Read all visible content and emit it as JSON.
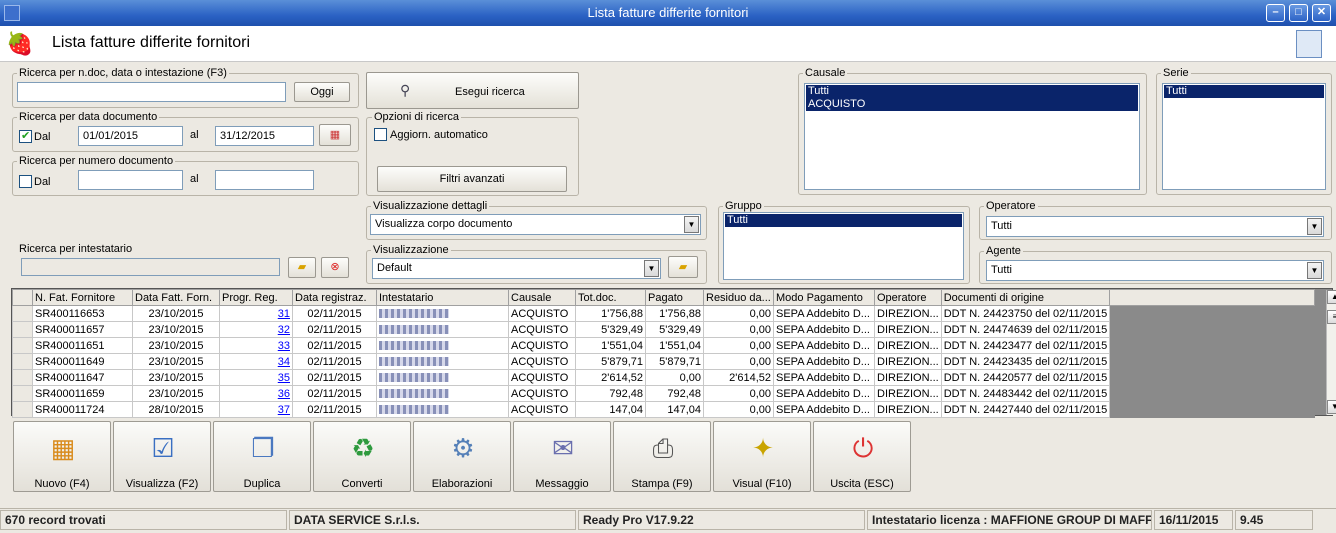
{
  "window": {
    "title": "Lista fatture differite fornitori"
  },
  "header": {
    "title": "Lista fatture differite fornitori"
  },
  "search_text": {
    "group_label": "Ricerca per n.doc, data o intestazione (F3)",
    "value": "",
    "oggi_label": "Oggi"
  },
  "search_date": {
    "group_label": "Ricerca per data documento",
    "dal_label": "Dal",
    "from": "01/01/2015",
    "al_label": "al",
    "to": "31/12/2015",
    "checked": true
  },
  "search_number": {
    "group_label": "Ricerca per numero documento",
    "dal_label": "Dal",
    "from": "",
    "al_label": "al",
    "to": "",
    "checked": false
  },
  "search_holder": {
    "group_label": "Ricerca per intestatario",
    "value": ""
  },
  "run_search_label": "Esegui ricerca",
  "search_options": {
    "group_label": "Opzioni di ricerca",
    "auto_update_label": "Aggiorn. automatico",
    "advanced_filters_label": "Filtri avanzati"
  },
  "detail_view": {
    "group_label": "Visualizzazione dettagli",
    "selected": "Visualizza corpo documento"
  },
  "view": {
    "group_label": "Visualizzazione",
    "selected": "Default"
  },
  "causale": {
    "group_label": "Causale",
    "items": [
      "Tutti",
      "ACQUISTO"
    ]
  },
  "serie": {
    "group_label": "Serie",
    "items": [
      "Tutti"
    ]
  },
  "gruppo": {
    "group_label": "Gruppo",
    "items": [
      "Tutti"
    ]
  },
  "operatore": {
    "group_label": "Operatore",
    "selected": "Tutti"
  },
  "agente": {
    "group_label": "Agente",
    "selected": "Tutti"
  },
  "table": {
    "columns": [
      "N. Fat. Fornitore",
      "Data Fatt. Forn.",
      "Progr. Reg.",
      "Data registraz.",
      "Intestatario",
      "Causale",
      "Tot.doc.",
      "Pagato",
      "Residuo da...",
      "Modo Pagamento",
      "Operatore",
      "Documenti di origine"
    ],
    "rows": [
      [
        "SR400116653",
        "23/10/2015",
        "31",
        "02/11/2015",
        "",
        "ACQUISTO",
        "1'756,88",
        "1'756,88",
        "0,00",
        "SEPA Addebito D...",
        "DIREZION...",
        "DDT N. 24423750 del 02/11/2015"
      ],
      [
        "SR400011657",
        "23/10/2015",
        "32",
        "02/11/2015",
        "",
        "ACQUISTO",
        "5'329,49",
        "5'329,49",
        "0,00",
        "SEPA Addebito D...",
        "DIREZION...",
        "DDT N. 24474639 del 02/11/2015"
      ],
      [
        "SR400011651",
        "23/10/2015",
        "33",
        "02/11/2015",
        "",
        "ACQUISTO",
        "1'551,04",
        "1'551,04",
        "0,00",
        "SEPA Addebito D...",
        "DIREZION...",
        "DDT N. 24423477 del 02/11/2015"
      ],
      [
        "SR400011649",
        "23/10/2015",
        "34",
        "02/11/2015",
        "",
        "ACQUISTO",
        "5'879,71",
        "5'879,71",
        "0,00",
        "SEPA Addebito D...",
        "DIREZION...",
        "DDT N. 24423435 del 02/11/2015"
      ],
      [
        "SR400011647",
        "23/10/2015",
        "35",
        "02/11/2015",
        "",
        "ACQUISTO",
        "2'614,52",
        "0,00",
        "2'614,52",
        "SEPA Addebito D...",
        "DIREZION...",
        "DDT N. 24420577 del 02/11/2015"
      ],
      [
        "SR400011659",
        "23/10/2015",
        "36",
        "02/11/2015",
        "",
        "ACQUISTO",
        "792,48",
        "792,48",
        "0,00",
        "SEPA Addebito D...",
        "DIREZION...",
        "DDT N. 24483442 del 02/11/2015"
      ],
      [
        "SR400011724",
        "28/10/2015",
        "37",
        "02/11/2015",
        "",
        "ACQUISTO",
        "147,04",
        "147,04",
        "0,00",
        "SEPA Addebito D...",
        "DIREZION...",
        "DDT N. 24427440 del 02/11/2015"
      ]
    ]
  },
  "toolbar": [
    {
      "label": "Nuovo (F4)",
      "icon": "new-document-icon"
    },
    {
      "label": "Visualizza (F2)",
      "icon": "view-document-icon"
    },
    {
      "label": "Duplica",
      "icon": "duplicate-icon"
    },
    {
      "label": "Converti",
      "icon": "convert-icon"
    },
    {
      "label": "Elaborazioni",
      "icon": "processing-icon"
    },
    {
      "label": "Messaggio",
      "icon": "message-icon"
    },
    {
      "label": "Stampa (F9)",
      "icon": "printer-icon"
    },
    {
      "label": "Visual (F10)",
      "icon": "magic-wand-icon"
    },
    {
      "label": "Uscita (ESC)",
      "icon": "exit-icon"
    }
  ],
  "statusbar": {
    "records": "670 record trovati",
    "company": "DATA SERVICE S.r.l.s.",
    "version": "Ready Pro V17.9.22",
    "license": "Intestatario licenza : MAFFIONE GROUP DI MAFFIO",
    "date": "16/11/2015",
    "time": "9.45"
  }
}
